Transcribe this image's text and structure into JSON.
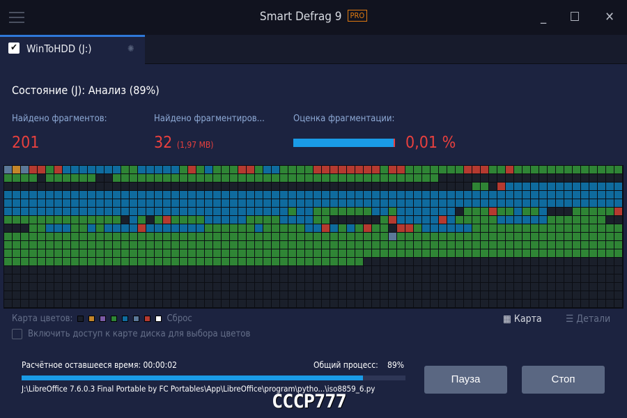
{
  "window": {
    "title": "Smart Defrag 9",
    "badge": "PRO",
    "minimize": "_",
    "maximize": "☐",
    "close": "✕"
  },
  "tab": {
    "label": "WinToHDD (J:)",
    "checked": true
  },
  "status": "Состояние (J): Анализ (89%)",
  "stats": [
    {
      "label": "Найдено фрагментов:",
      "value": "201"
    },
    {
      "label": "Найдено фрагментиров...",
      "value": "32",
      "extra": "(1,97 MB)"
    },
    {
      "label": "Оценка фрагментации:",
      "value": "0,01 %",
      "bar_fill_percent": 99
    }
  ],
  "colors": {
    "d": "#1a1f2a",
    "g": "#2f8535",
    "b": "#0f6b9e",
    "r": "#b53a30",
    "o": "#c4862a",
    "s": "#5b7898",
    "p": "#7b5aa6",
    "w": "#ffffff",
    "accent": "#1a9be6",
    "value_red": "#e8403e"
  },
  "disk_map": [
    "sosrrgrbbbbbbbggbbbbbgrgbgggrrgbbggggrrrrrrrrgrrgggggggrrrggrggggggggggggg",
    "ggggdggggggddgggggggggggggggggggggggggggggggggggggggdddddddddddddddddddddd",
    "ddddddddddddddddddddddddddddddddddddddddddddddddddddddddggdrbbbbbbbbbbbbbb",
    "bbbbbbbbbbbbbbbbbbbbbbbbbbbbbbbbbbbbbbbbbbbbbbbbbbbbbbbbbbbbbbbbbbbbbbbbbb",
    "bbbbbbbbbbbbbbbbbbbbbbbbbbbbbbbbbbbbbbbbbbbbbbbbbbbbbbbbbbbbbbbbbbbbbbbbbb",
    "bbbbbbbbbbbbbbbbbbbbbbbbbbbbbbbbbbgbbgggggggbbgbbbbbbbdgggrggbggbdddgggggr",
    "ggggggggggggggdbgdgrggggbbbbbggggbbbbggddddddgrbbbbbrbgggggbbbbbbgggggggdd",
    "dddggbbbggbgbbbbrbbbbbbbggggggbgggggbbrbgbgrggdrrgbbbbbbgggggggggggggggggg",
    "ggggggggggggggggggggggggggggggggggggggggggggggsggggggggggggggggggggggggggg",
    "gggggggggggggggggggggggggggggggggggggggggggggggggggggggggggggggggggggggggg",
    "gggggggggggggggggggggggggggggggggggggggggggggggggggggggggggggggggggggggggg",
    "gggggggggggggggggggggggggggggggggggggggggggdddddddddddddddddddddddddddddddd",
    "dddddddddddddddddddddddddddddddddddddddddddddddddddddddddddddddddddddddddd",
    "dddddddddddddddddddddddddddddddddddddddddddddddddddddddddddddddddddddddddd",
    "dddddddddddddddddddddddddddddddddddddddddddddddddddddddddddddddddddddddddd",
    "dddddddddddddddddddddddddddddddddddddddddddddddddddddddddddddddddddddddddd",
    "dddddddddddddddddddddddddddddddddddddddddddddddddddddddddddddddddddddddddd"
  ],
  "legend": {
    "label": "Карта цветов:",
    "swatches": [
      "d",
      "o",
      "p",
      "g",
      "b",
      "s",
      "r",
      "w"
    ],
    "reset": "Сброс"
  },
  "enable_checkbox": {
    "label": "Включить доступ к карте диска для выбора цветов",
    "checked": false
  },
  "views": {
    "map": "Карта",
    "details": "Детали",
    "active": "map"
  },
  "progress": {
    "remaining_label": "Расчётное оставшееся время: 00:00:02",
    "total_label": "Общий процесс:",
    "total_value": "89%",
    "percent": 89,
    "current_file": "J:\\LibreOffice 7.6.0.3 Final Portable by FC Portables\\App\\LibreOffice\\program\\pytho...\\iso8859_6.py"
  },
  "watermark": "СССР777",
  "buttons": {
    "pause": "Пауза",
    "stop": "Стоп"
  }
}
